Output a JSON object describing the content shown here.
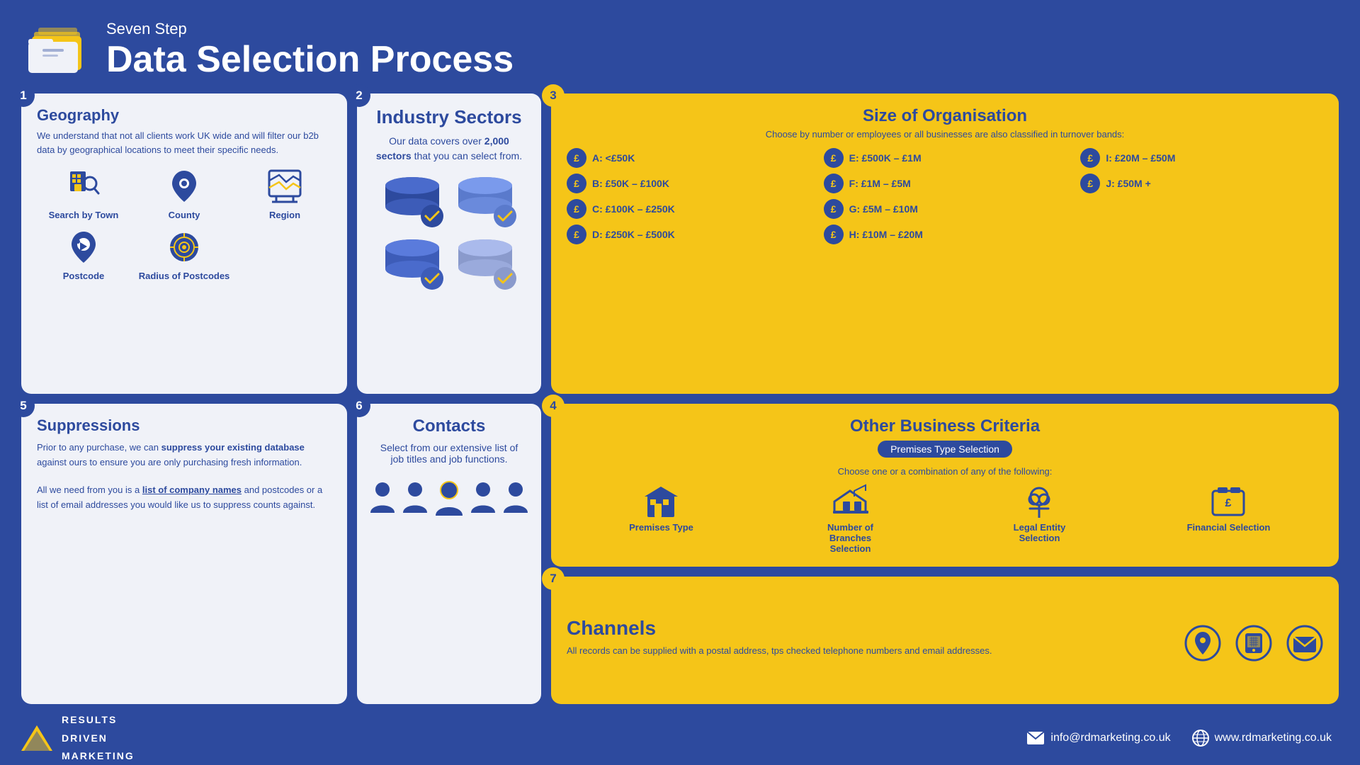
{
  "header": {
    "subtitle": "Seven Step",
    "main_title": "Data Selection Process"
  },
  "step1": {
    "badge": "1",
    "title": "Geography",
    "desc": "We understand that not all clients work UK wide and will filter our b2b data by geographical locations to meet their specific needs.",
    "icons": [
      {
        "label": "Search by Town",
        "icon": "building"
      },
      {
        "label": "County",
        "icon": "map-pin"
      },
      {
        "label": "Region",
        "icon": "region"
      },
      {
        "label": "Postcode",
        "icon": "postcode"
      },
      {
        "label": "Radius of Postcodes",
        "icon": "radius"
      }
    ]
  },
  "step2": {
    "badge": "2",
    "title": "Industry Sectors",
    "desc": "Our data covers over 2,000 sectors that you can select from."
  },
  "step3": {
    "badge": "3",
    "title": "Size of Organisation",
    "subtitle": "Choose by number or employees or all businesses are also classified in turnover bands:",
    "bands": [
      {
        "label": "A: <£50K"
      },
      {
        "label": "E: £500K – £1M"
      },
      {
        "label": "I: £20M – £50M"
      },
      {
        "label": "B: £50K – £100K"
      },
      {
        "label": "F: £1M – £5M"
      },
      {
        "label": "J: £50M +"
      },
      {
        "label": "C: £100K – £250K"
      },
      {
        "label": "G: £5M – £10M"
      },
      {
        "label": ""
      },
      {
        "label": "D: £250K – £500K"
      },
      {
        "label": "H: £10M – £20M"
      },
      {
        "label": ""
      }
    ]
  },
  "step4": {
    "badge": "4",
    "title": "Other Business Criteria",
    "badge_text": "Premises Type Selection",
    "subtitle": "Choose one or a combination of any of the following:",
    "criteria": [
      {
        "label": "Premises Type",
        "icon": "building-criteria"
      },
      {
        "label": "Number of Branches Selection",
        "icon": "branches"
      },
      {
        "label": "Legal Entity Selection",
        "icon": "legal"
      },
      {
        "label": "Financial Selection",
        "icon": "financial"
      }
    ]
  },
  "step5": {
    "badge": "5",
    "title": "Suppressions",
    "para1": "Prior to any purchase, we can suppress your existing database against ours to ensure you are only purchasing fresh information.",
    "para2_before": "All we need from you is a ",
    "para2_link": "list of company names",
    "para2_after": " and postcodes or a list of email addresses you would like us to suppress counts against."
  },
  "step6": {
    "badge": "6",
    "title": "Contacts",
    "desc": "Select from our extensive list of job titles and job functions."
  },
  "step7": {
    "badge": "7",
    "title": "Channels",
    "desc": "All records can be supplied with a postal address, tps checked telephone numbers and email addresses."
  },
  "footer": {
    "brand_lines": [
      "RESULTS",
      "DRIVEN",
      "MARKETING"
    ],
    "email": "info@rdmarketing.co.uk",
    "website": "www.rdmarketing.co.uk"
  }
}
